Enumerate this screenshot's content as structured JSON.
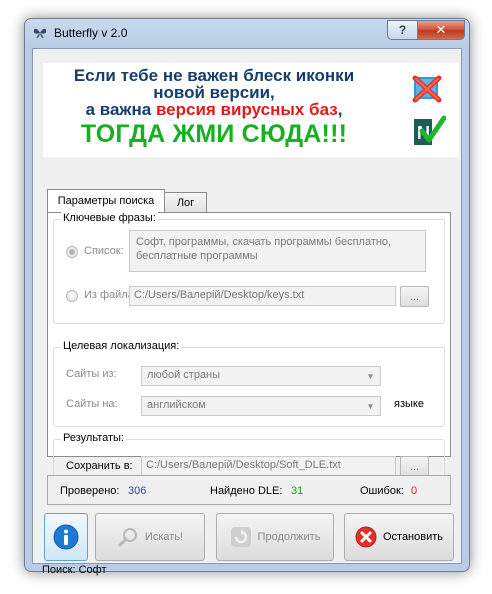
{
  "window": {
    "title": "Butterfly v 2.0",
    "help_glyph": "?",
    "close_glyph": "✕"
  },
  "banner": {
    "line1": "Если тебе не важен блеск иконки",
    "line2": "новой версии,",
    "line3_prefix": "а важна ",
    "line3_red": "версия вирусных баз",
    "line3_suffix": ",",
    "line4": "ТОГДА ЖМИ СЮДА!!!",
    "accent_red": "#e11b1b",
    "accent_green": "#17b021",
    "text_blue": "#173e6b"
  },
  "tabs": [
    {
      "label": "Параметры поиска",
      "active": true
    },
    {
      "label": "Лог",
      "active": false
    }
  ],
  "keyphrases": {
    "legend": "Ключевые фразы:",
    "list_label": "Список:",
    "list_value": "Софт, программы, скачать программы бесплатно, бесплатные программы",
    "file_label": "Из файла:",
    "file_value": "C:/Users/Валерій/Desktop/keys.txt",
    "browse_label": "..."
  },
  "localization": {
    "legend": "Целевая локализация:",
    "sites_from_label": "Сайты из:",
    "sites_from_value": "любой страны",
    "sites_on_label": "Сайты на:",
    "sites_on_value": "английском",
    "suffix": "языке"
  },
  "results": {
    "legend": "Результаты:",
    "save_label": "Сохранить в:",
    "save_value": "C:/Users/Валерій/Desktop/Soft_DLE.txt",
    "browse_label": "..."
  },
  "status": {
    "checked_label": "Проверено:",
    "checked_value": "306",
    "checked_color": "#2b3fd1",
    "found_label": "Найдено DLE:",
    "found_value": "31",
    "found_color": "#14a21b",
    "errors_label": "Ошибок:",
    "errors_value": "0",
    "errors_color": "#e02020"
  },
  "buttons": {
    "info_icon": "info-icon",
    "search_label": "Искать!",
    "continue_label": "Продолжить",
    "stop_label": "Остановить"
  },
  "footer": {
    "search_text": "Поиск: Софт"
  }
}
